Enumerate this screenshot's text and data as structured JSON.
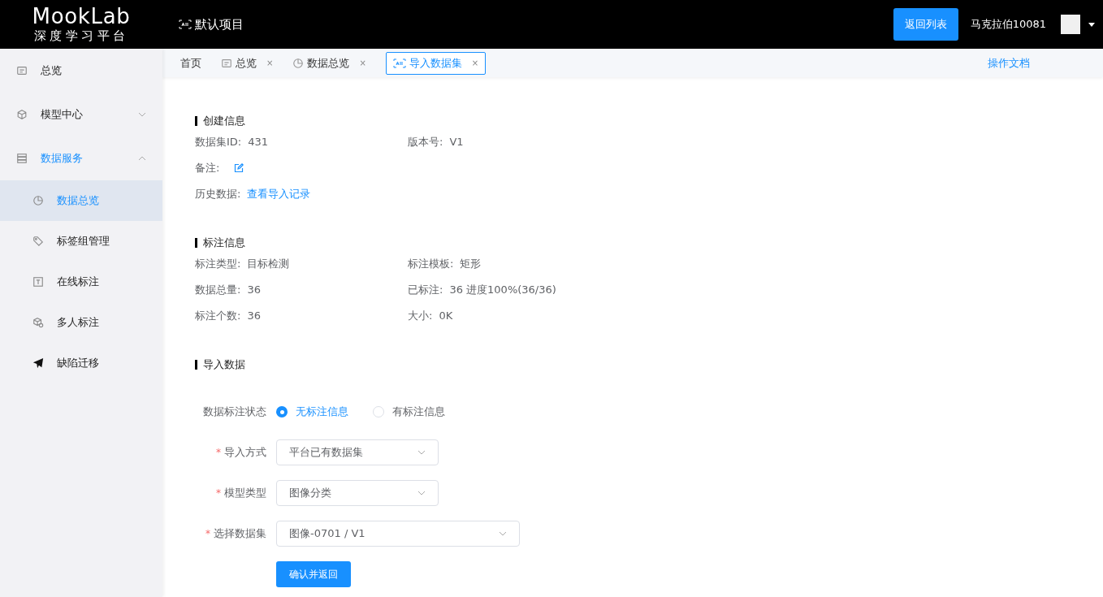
{
  "header": {
    "logo_title": "MookLab",
    "logo_subtitle": "深度学习平台",
    "project": "默认项目",
    "back_button": "返回列表",
    "username": "马克拉伯10081"
  },
  "sidebar": {
    "items": [
      {
        "label": "总览",
        "selected": false
      },
      {
        "label": "模型中心",
        "selected": false,
        "expanded": false
      },
      {
        "label": "数据服务",
        "selected": false,
        "expanded": true,
        "children": [
          {
            "label": "数据总览",
            "selected": true
          },
          {
            "label": "标签组管理",
            "selected": false
          },
          {
            "label": "在线标注",
            "selected": false
          },
          {
            "label": "多人标注",
            "selected": false
          },
          {
            "label": "缺陷迁移",
            "selected": false
          }
        ]
      }
    ]
  },
  "tabs": [
    {
      "label": "首页",
      "selected": false
    },
    {
      "label": "总览",
      "selected": false,
      "close": "×"
    },
    {
      "label": "数据总览",
      "selected": false,
      "close": "×"
    },
    {
      "label": "导入数据集",
      "selected": true,
      "close": "×"
    }
  ],
  "docs_link": "操作文档",
  "sections": [
    {
      "title": "创建信息",
      "rows": [
        [
          {
            "label": "数据集ID:",
            "kind": "text",
            "value": "431"
          },
          {
            "label": "版本号:",
            "kind": "text",
            "value": "V1"
          }
        ],
        [
          {
            "label": "备注:",
            "kind": "edit"
          }
        ],
        [
          {
            "label": "历史数据:",
            "kind": "link",
            "value": "查看导入记录"
          }
        ]
      ]
    },
    {
      "title": "标注信息",
      "rows": [
        [
          {
            "label": "标注类型:",
            "kind": "text",
            "value": "目标检测"
          },
          {
            "label": "标注模板:",
            "kind": "text",
            "value": "矩形"
          }
        ],
        [
          {
            "label": "数据总量:",
            "kind": "text",
            "value": "36"
          },
          {
            "label": "已标注:",
            "kind": "text",
            "value": "36 进度100%(36/36)"
          }
        ],
        [
          {
            "label": "标注个数:",
            "kind": "text",
            "value": "36"
          },
          {
            "label": "大小:",
            "kind": "text",
            "value": "0K"
          }
        ]
      ]
    },
    {
      "title": "导入数据"
    }
  ],
  "form": {
    "radio_label": "数据标注状态",
    "radio_options": [
      {
        "label": "无标注信息",
        "selected": true
      },
      {
        "label": "有标注信息",
        "selected": false
      }
    ],
    "selects": [
      {
        "label": "导入方式",
        "required_mark": "*",
        "value": "平台已有数据集"
      },
      {
        "label": "模型类型",
        "required_mark": "*",
        "value": "图像分类"
      },
      {
        "label": "选择数据集",
        "required_mark": "*",
        "value": "图像-0701 / V1"
      }
    ],
    "submit": "确认并返回"
  }
}
